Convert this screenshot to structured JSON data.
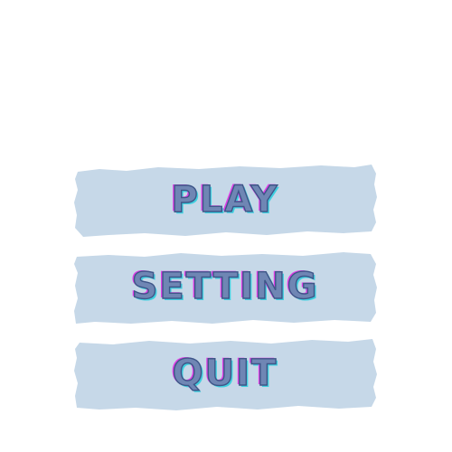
{
  "colors": {
    "background": "#ffffff",
    "button_fill": "#c6d8e8",
    "label_fill": "#6f86b4",
    "label_outline": "#3e5688",
    "label_shadow_magenta": "#e03de6",
    "label_shadow_cyan": "#3fd0e0"
  },
  "menu": {
    "play_label": "PLAY",
    "setting_label": "SETTING",
    "quit_label": "QUIT"
  }
}
